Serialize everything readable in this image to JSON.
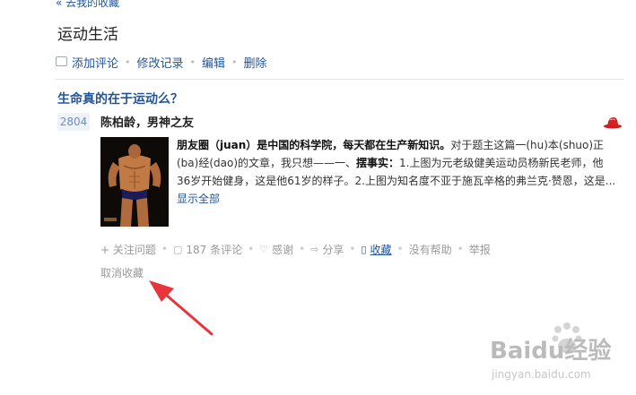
{
  "nav": {
    "back_link": "« 去我的收藏"
  },
  "collection": {
    "title": "运动生活"
  },
  "toolbar": {
    "add_comment": "添加评论",
    "edit_history": "修改记录",
    "edit": "编辑",
    "delete": "删除",
    "separator": "•"
  },
  "question": {
    "title": "生命真的在于运动么？"
  },
  "answer": {
    "votes": "2804",
    "author": "陈柏龄，男神之友",
    "text_bold_1": "朋友圈（juan）是中国的科学院，每天都在生产新知识。",
    "text_1": "对于题主这篇一(hu)本(shuo)正(ba)经(dao)的文章，我只想——一、",
    "text_bold_2": "摆事实：",
    "text_2": "1.上图为元老级健美运动员杨新民老师，他36岁开始健身，这是他61岁的样子。2.上图为知名度不亚于施瓦辛格的弗兰克·赞恩，这是...",
    "show_all": "显示全部"
  },
  "actions": {
    "follow": "+ 关注问题",
    "comments": "187 条评论",
    "thanks": "感谢",
    "share": "分享",
    "collect": "收藏",
    "no_help": "没有帮助",
    "report": "举报",
    "separator": "•",
    "uncollect": "取消收藏"
  },
  "watermark": {
    "brand": "Baidu经验",
    "url": "jingyan.baidu.com"
  },
  "colors": {
    "link": "#225599",
    "muted": "#999999",
    "arrow": "#e8353b",
    "badge_bg": "#eef3fa"
  }
}
